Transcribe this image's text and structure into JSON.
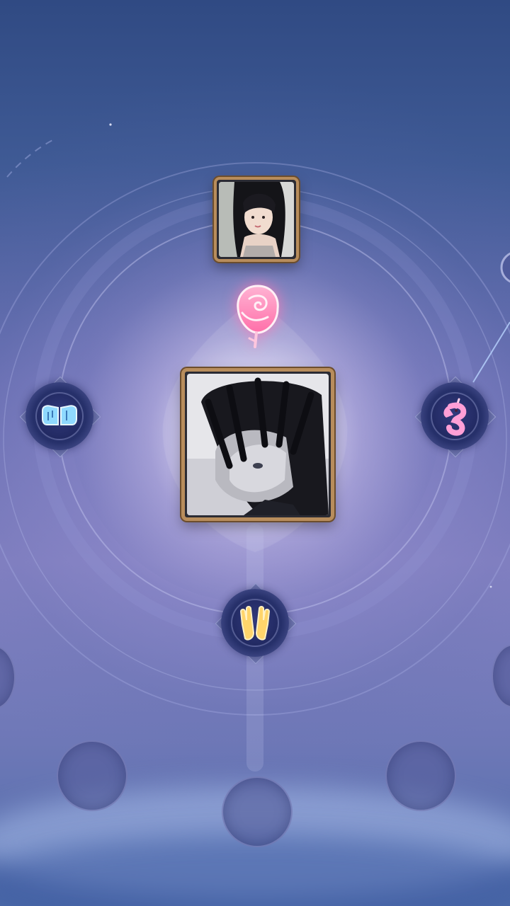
{
  "scene": {
    "name": "relationship-bond-screen",
    "accent_color": "#b88d5c",
    "glow_color": "#ff8ec0"
  },
  "top_portrait": {
    "icon": "female-avatar-photo",
    "frame_color": "#b88d5c"
  },
  "center_portrait": {
    "icon": "male-avatar-photo",
    "frame_color": "#b88d5c"
  },
  "bond_icon": {
    "icon": "pink-rose-icon",
    "color": "#ff7fb4"
  },
  "gift_nodes": [
    {
      "id": "left",
      "icon": "fist-bump-icon",
      "color": "#7fd3ff"
    },
    {
      "id": "right",
      "icon": "unicorn-icon",
      "color": "#ff93d0"
    },
    {
      "id": "bottom",
      "icon": "high-five-hands-icon",
      "color": "#ffd56b"
    }
  ],
  "empty_slots": [
    {
      "id": "bottom-left",
      "state": "empty"
    },
    {
      "id": "bottom-center",
      "state": "empty"
    },
    {
      "id": "bottom-right",
      "state": "empty"
    },
    {
      "id": "left-edge",
      "state": "empty"
    },
    {
      "id": "right-edge",
      "state": "empty"
    }
  ]
}
